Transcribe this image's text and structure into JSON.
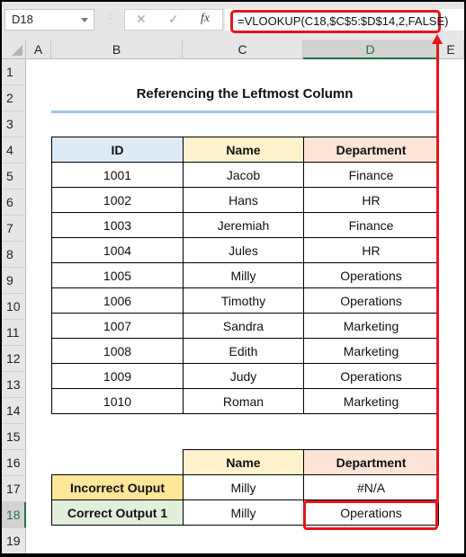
{
  "formula_bar": {
    "name_box": "D18",
    "cancel_icon": "✕",
    "enter_icon": "✓",
    "fx_label": "fx",
    "formula": "=VLOOKUP(C18,$C$5:$D$14,2,FALSE)"
  },
  "columns": [
    "A",
    "B",
    "C",
    "D",
    "E"
  ],
  "selected_column": "D",
  "rows": [
    "1",
    "2",
    "3",
    "4",
    "5",
    "6",
    "7",
    "8",
    "9",
    "10",
    "11",
    "12",
    "13",
    "14",
    "15",
    "16",
    "17",
    "18",
    "19"
  ],
  "selected_row": "18",
  "title": "Referencing the Leftmost Column",
  "main_table": {
    "headers": [
      "ID",
      "Name",
      "Department"
    ],
    "rows": [
      [
        "1001",
        "Jacob",
        "Finance"
      ],
      [
        "1002",
        "Hans",
        "HR"
      ],
      [
        "1003",
        "Jeremiah",
        "Finance"
      ],
      [
        "1004",
        "Jules",
        "HR"
      ],
      [
        "1005",
        "Milly",
        "Operations"
      ],
      [
        "1006",
        "Timothy",
        "Operations"
      ],
      [
        "1007",
        "Sandra",
        "Marketing"
      ],
      [
        "1008",
        "Edith",
        "Marketing"
      ],
      [
        "1009",
        "Judy",
        "Operations"
      ],
      [
        "1010",
        "Roman",
        "Marketing"
      ]
    ]
  },
  "output_table": {
    "headers": [
      "Name",
      "Department"
    ],
    "rows": [
      {
        "label": "Incorrect Ouput",
        "name": "Milly",
        "department": "#N/A"
      },
      {
        "label": "Correct Output 1",
        "name": "Milly",
        "department": "Operations"
      }
    ]
  },
  "colors": {
    "highlight": "#e8141c",
    "selection": "#217346",
    "id_header": "#ddebf7",
    "name_header": "#fff2cc",
    "dept_header": "#fce4d6",
    "incorrect_label": "#ffe699",
    "correct_label": "#e2efda"
  }
}
